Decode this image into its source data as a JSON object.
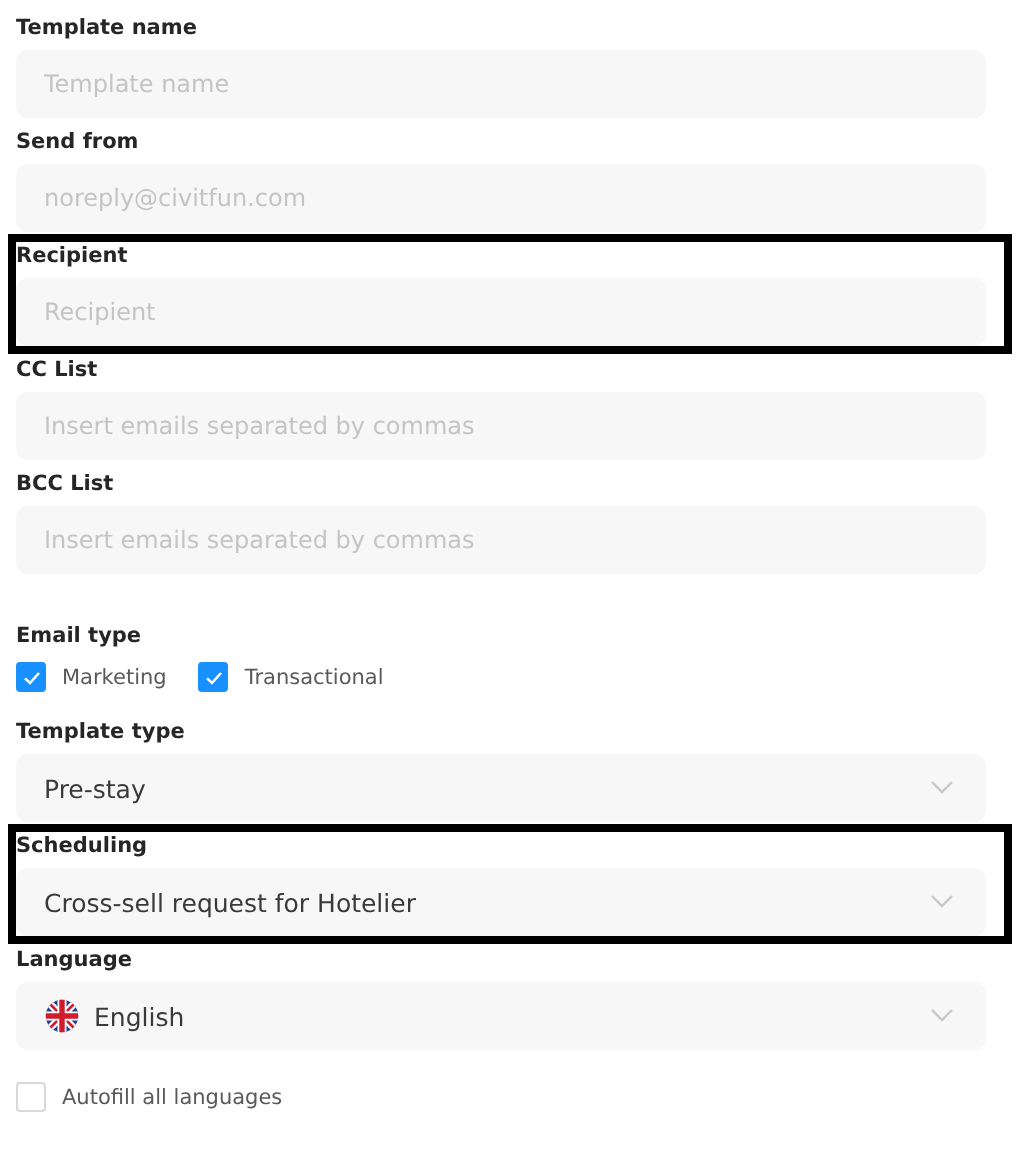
{
  "fields": [
    {
      "kind": "text",
      "label": "Template name",
      "placeholder": "Template name",
      "highlighted": false
    },
    {
      "kind": "text",
      "label": "Send from",
      "placeholder": "noreply@civitfun.com",
      "highlighted": false
    },
    {
      "kind": "text",
      "label": "Recipient",
      "placeholder": "Recipient",
      "highlighted": true
    },
    {
      "kind": "text",
      "label": "CC List",
      "placeholder": "Insert emails separated by commas",
      "highlighted": false
    },
    {
      "kind": "text",
      "label": "BCC List",
      "placeholder": "Insert emails separated by commas",
      "highlighted": false
    },
    {
      "kind": "checkboxes",
      "label": "Email type",
      "options": [
        {
          "label": "Marketing",
          "checked": true
        },
        {
          "label": "Transactional",
          "checked": true
        }
      ]
    },
    {
      "kind": "select",
      "label": "Template type",
      "value": "Pre-stay",
      "highlighted": false
    },
    {
      "kind": "select",
      "label": "Scheduling",
      "value": "Cross-sell request for Hotelier",
      "highlighted": true
    },
    {
      "kind": "language",
      "label": "Language",
      "value": "English",
      "highlighted": false
    },
    {
      "kind": "checkbox",
      "label": "Autofill all languages",
      "checked": false
    }
  ]
}
